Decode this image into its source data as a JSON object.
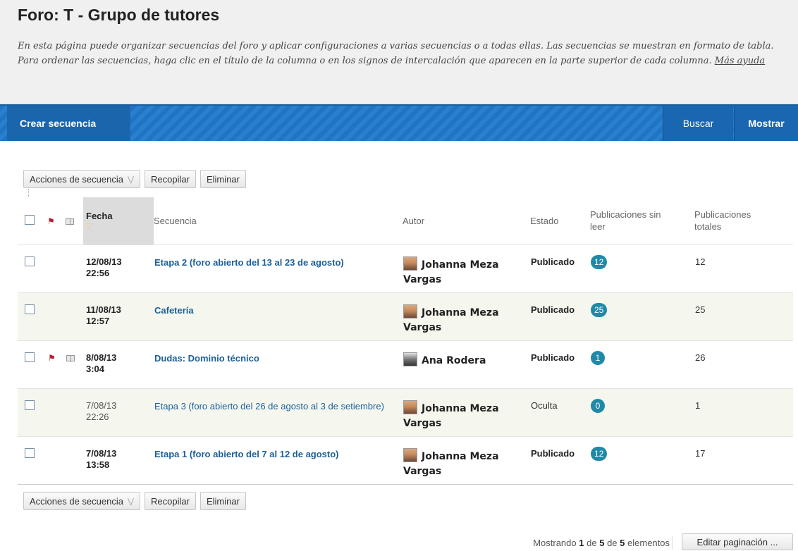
{
  "header": {
    "title": "Foro: T - Grupo de tutores",
    "description": "En esta página puede organizar secuencias del foro y aplicar configuraciones a varias secuencias o a todas ellas. Las secuencias se muestran en formato de tabla. Para ordenar las secuencias, haga clic en el título de la columna o en los signos de intercalación que aparecen en la parte superior de cada columna.",
    "help_link": "Más ayuda"
  },
  "actionbar": {
    "create": "Crear secuencia",
    "search": "Buscar",
    "show": "Mostrar"
  },
  "toolbar": {
    "actions": "Acciones de secuencia",
    "collect": "Recopilar",
    "delete": "Eliminar"
  },
  "columns": {
    "date": "Fecha",
    "thread": "Secuencia",
    "author": "Autor",
    "state": "Estado",
    "unread": "Publicaciones sin leer",
    "total": "Publicaciones totales"
  },
  "threads": [
    {
      "date": "12/08/13\n22:56",
      "title": "Etapa 2 (foro abierto del 13 al 23 de agosto)",
      "author": "Johanna Meza Vargas",
      "state": "Publicado",
      "unread": "12",
      "total": "12",
      "bold": true,
      "flagged": false
    },
    {
      "date": "11/08/13\n12:57",
      "title": "Cafetería",
      "author": "Johanna Meza Vargas",
      "state": "Publicado",
      "unread": "25",
      "total": "25",
      "bold": true,
      "flagged": false
    },
    {
      "date": "8/08/13\n3:04",
      "title": "Dudas: Dominio técnico",
      "author": "Ana Rodera",
      "state": "Publicado",
      "unread": "1",
      "total": "26",
      "bold": true,
      "flagged": true
    },
    {
      "date": "7/08/13\n22:26",
      "title": "Etapa 3 (foro abierto del 26 de agosto al 3 de setiembre)",
      "author": "Johanna Meza Vargas",
      "state": "Oculta",
      "unread": "0",
      "total": "1",
      "bold": false,
      "flagged": false
    },
    {
      "date": "7/08/13\n13:58",
      "title": "Etapa 1 (foro abierto del 7 al 12 de agosto)",
      "author": "Johanna Meza Vargas",
      "state": "Publicado",
      "unread": "12",
      "total": "17",
      "bold": true,
      "flagged": false
    }
  ],
  "pagination": {
    "prefix": "Mostrando",
    "from": "1",
    "of1": "de",
    "to": "5",
    "of2": "de",
    "total": "5",
    "suffix": "elementos",
    "edit": "Editar paginación ..."
  },
  "colors": {
    "accent": "#1f74c4",
    "badge": "#1f8aa8",
    "link": "#1d5f96",
    "flag": "#b0202a"
  }
}
